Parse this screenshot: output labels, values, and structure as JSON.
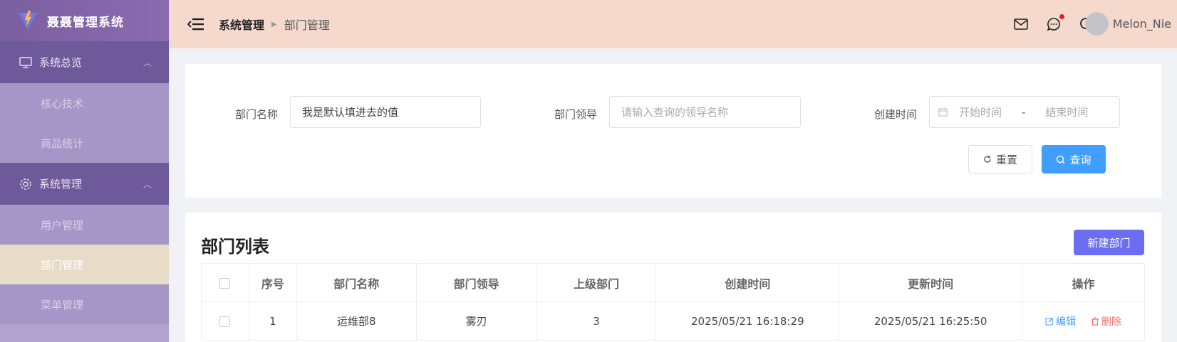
{
  "app": {
    "title": "聂聂管理系统"
  },
  "sidebar": {
    "groups": [
      {
        "label": "系统总览",
        "icon": "monitor-icon",
        "items": [
          "核心技术",
          "商品统计"
        ]
      },
      {
        "label": "系统管理",
        "icon": "gear-icon",
        "items": [
          "用户管理",
          "部门管理",
          "菜单管理"
        ]
      }
    ],
    "active": "部门管理"
  },
  "header": {
    "breadcrumb": [
      "系统管理",
      "部门管理"
    ],
    "user": "Melon_Nie",
    "icons": [
      "mail-icon",
      "chat-icon",
      "search-icon"
    ]
  },
  "search": {
    "dept_name_label": "部门名称",
    "dept_name_value": "我是默认填进去的值",
    "leader_label": "部门领导",
    "leader_placeholder": "请输入查询的领导名称",
    "created_label": "创建时间",
    "start_placeholder": "开始时间",
    "range_sep": "-",
    "end_placeholder": "结束时间",
    "reset_label": "重置",
    "query_label": "查询"
  },
  "table": {
    "title": "部门列表",
    "new_button": "新建部门",
    "headers": [
      "序号",
      "部门名称",
      "部门领导",
      "上级部门",
      "创建时间",
      "更新时间",
      "操作"
    ],
    "rows": [
      {
        "index": "1",
        "name": "运维部8",
        "leader": "雾刃",
        "parent": "3",
        "created": "2025/05/21 16:18:29",
        "updated": "2025/05/21 16:25:50"
      }
    ],
    "edit_label": "编辑",
    "delete_label": "删除"
  },
  "colors": {
    "accent": "#409eff",
    "sidebar": "#b3a3cf",
    "header": "#f5d9cc",
    "new_button": "#6b6ef0",
    "danger": "#f56c6c"
  }
}
